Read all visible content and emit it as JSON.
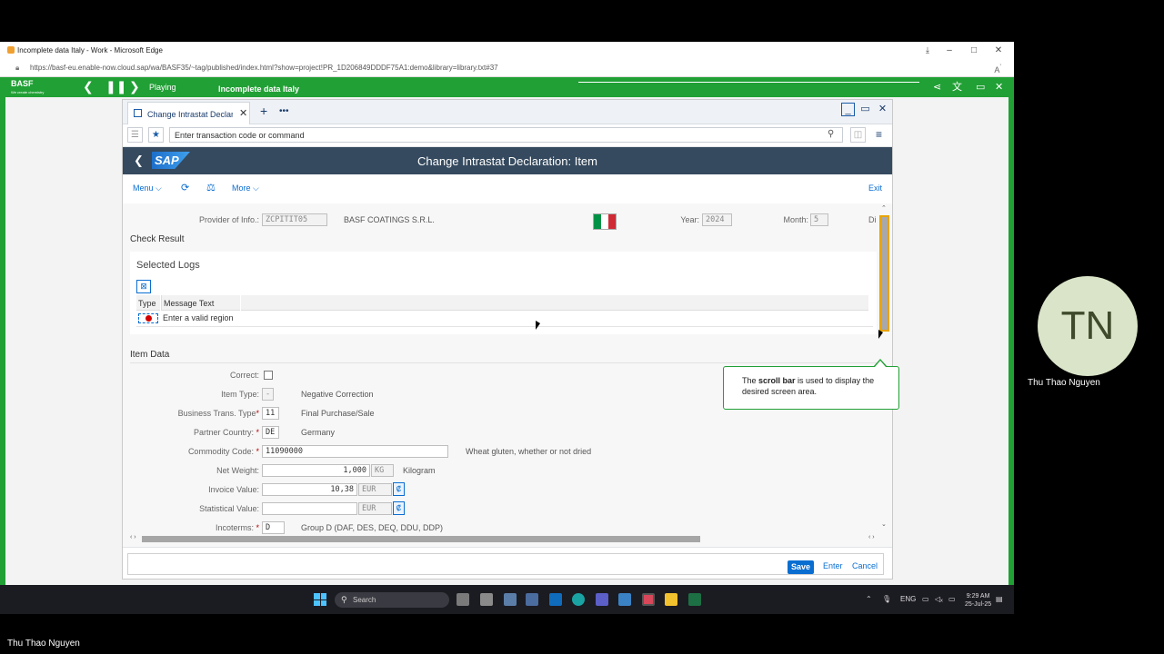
{
  "browser": {
    "title": "Incomplete data Italy - Work - Microsoft Edge",
    "url": "https://basf-eu.enable-now.cloud.sap/wa/BASF35/~tag/published/index.html?show=project!PR_1D206849DDDF75A1:demo&library=library.txt#37"
  },
  "player": {
    "brand": "BASF",
    "brand_tagline": "We create chemistry",
    "status": "Playing",
    "title": "Incomplete data Italy"
  },
  "sap": {
    "tab_label": "Change Intrastat Declaration: Item",
    "command_placeholder": "Enter transaction code or command",
    "logo_text": "SAP",
    "page_title": "Change Intrastat Declaration: Item",
    "toolbar": {
      "menu": "Menu",
      "more": "More",
      "exit": "Exit"
    },
    "header_fields": {
      "provider_label": "Provider of Info.:",
      "provider_value": "ZCPITIT05",
      "provider_name": "BASF COATINGS S.R.L.",
      "year_label": "Year:",
      "year_value": "2024",
      "month_label": "Month:",
      "month_value": "5",
      "dir_label": "Dir"
    },
    "flag_colors": [
      "#009246",
      "#ffffff",
      "#ce2b37"
    ],
    "check_result": {
      "title": "Check Result",
      "panel_title": "Selected Logs",
      "columns": [
        "Type",
        "Message Text"
      ],
      "rows": [
        {
          "type": "error",
          "message": "Enter a valid region"
        }
      ]
    },
    "item_data": {
      "title": "Item Data",
      "correct_label": "Correct:",
      "item_type_label": "Item Type:",
      "item_type_value": "-",
      "item_type_text": "Negative Correction",
      "bus_trans_label": "Business Trans. Type",
      "bus_trans_value": "11",
      "bus_trans_text": "Final Purchase/Sale",
      "partner_label": "Partner Country:",
      "partner_value": "DE",
      "partner_text": "Germany",
      "commodity_label": "Commodity Code:",
      "commodity_value": "11090000",
      "commodity_text": "Wheat gluten, whether or not dried",
      "net_weight_label": "Net Weight:",
      "net_weight_value": "1,000",
      "net_weight_unit": "KG",
      "net_weight_text": "Kilogram",
      "invoice_label": "Invoice Value:",
      "invoice_value": "10,38",
      "invoice_currency": "EUR",
      "stat_label": "Statistical Value:",
      "stat_value": "",
      "stat_currency": "EUR",
      "incoterms_label": "Incoterms:",
      "incoterms_value": "D",
      "incoterms_text": "Group D (DAF, DES, DEQ, DDU, DDP)"
    },
    "footer": {
      "save": "Save",
      "enter": "Enter",
      "cancel": "Cancel"
    }
  },
  "tooltip": {
    "before": "The ",
    "bold": "scroll bar",
    "after": " is used to display the desired screen area."
  },
  "taskbar": {
    "search_placeholder": "Search",
    "lang": "ENG",
    "time": "9:29 AM",
    "date": "25-Jul-25"
  },
  "participant": {
    "initials": "TN",
    "name": "Thu Thao Nguyen"
  },
  "self_name": "Thu Thao Nguyen"
}
